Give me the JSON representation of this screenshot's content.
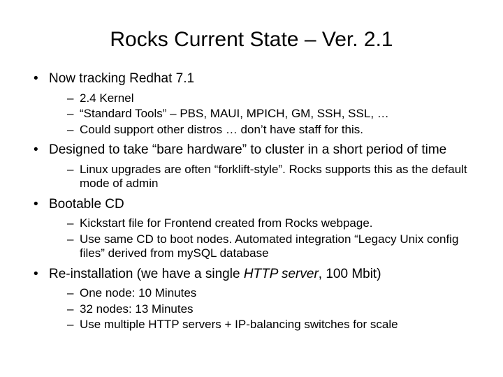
{
  "title": "Rocks Current State – Ver. 2.1",
  "b1": {
    "label": "Now tracking Redhat 7.1",
    "s1": "2.4 Kernel",
    "s2": "“Standard Tools” – PBS, MAUI, MPICH, GM, SSH, SSL, …",
    "s3": "Could support other distros … don’t have staff for this."
  },
  "b2": {
    "label": "Designed to take “bare hardware” to cluster in a short period of time",
    "s1": "Linux upgrades are often “forklift-style”. Rocks supports this as the default mode of admin"
  },
  "b3": {
    "label": "Bootable CD",
    "s1": "Kickstart file for Frontend created from Rocks webpage.",
    "s2": "Use same CD to boot nodes. Automated integration “Legacy Unix config files” derived from mySQL database"
  },
  "b4": {
    "prefix": "Re-installation (we have a single ",
    "italic": "HTTP server",
    "suffix": ", 100 Mbit)",
    "s1": "One node: 10 Minutes",
    "s2": "32 nodes: 13 Minutes",
    "s3": "Use multiple HTTP servers + IP-balancing switches for scale"
  }
}
